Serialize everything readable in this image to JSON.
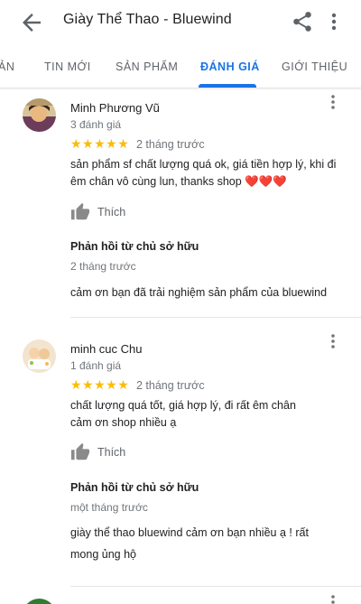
{
  "app_bar": {
    "title": "Giày Thể Thao - Bluewind",
    "back_icon": "arrow-back-icon",
    "share_icon": "share-icon",
    "more_icon": "more-vert-icon"
  },
  "tabs": [
    {
      "label": "ẢN"
    },
    {
      "label": "TIN MỚI"
    },
    {
      "label": "SẢN PHẨM"
    },
    {
      "label": "ĐÁNH GIÁ",
      "active": true
    },
    {
      "label": "GIỚI THIỆU"
    }
  ],
  "colors": {
    "accent": "#1a73e8",
    "star": "#fbbc04",
    "heart": "#e53935",
    "secondary_text": "#70757a"
  },
  "reviews": [
    {
      "name": "Minh Phương Vũ",
      "review_count": "3 đánh giá",
      "stars": "★★★★★",
      "rating": 5,
      "date": "2 tháng trước",
      "text": "sản phẩm sf chất lượng quá ok, giá tiền hợp lý, khi đi êm chân vô cùng lun, thanks shop ❤️❤️❤️",
      "like_label": "Thích",
      "owner_reply_title": "Phản hồi từ chủ sở hữu",
      "owner_reply_date": "2 tháng trước",
      "owner_reply_text": "cảm ơn bạn đã trải nghiệm sản phẩm của bluewind"
    },
    {
      "name": "minh cuc Chu",
      "review_count": "1 đánh giá",
      "stars": "★★★★★",
      "rating": 5,
      "date": "2 tháng trước",
      "text": "chất lượng quá tốt, giá hợp lý, đi rất êm chân cảm ơn shop nhiều ạ",
      "like_label": "Thích",
      "owner_reply_title": "Phản hồi từ chủ sở hữu",
      "owner_reply_date": "một tháng trước",
      "owner_reply_text": "giày thể thao bluewind cảm ơn bạn nhiều ạ ! rất mong ủng hộ"
    }
  ]
}
